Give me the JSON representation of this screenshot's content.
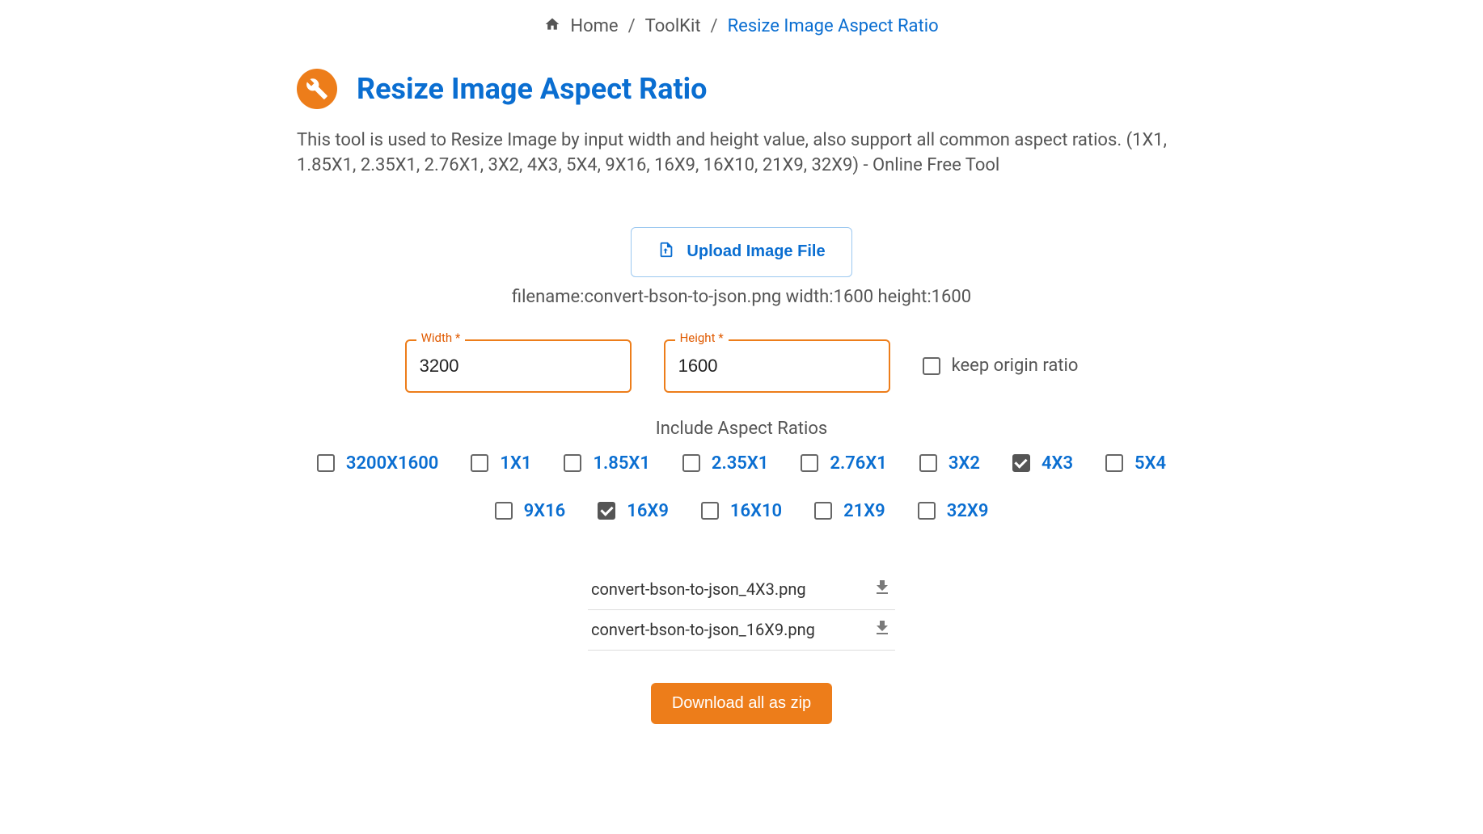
{
  "breadcrumb": {
    "home": "Home",
    "mid": "ToolKit",
    "current": "Resize Image Aspect Ratio"
  },
  "title": "Resize Image Aspect Ratio",
  "description": "This tool is used to Resize Image by input width and height value, also support all common aspect ratios. (1X1, 1.85X1, 2.35X1, 2.76X1, 3X2, 4X3, 5X4, 9X16, 16X9, 16X10, 21X9, 32X9) - Online Free Tool",
  "upload": {
    "label": "Upload Image File"
  },
  "file_meta": "filename:convert-bson-to-json.png width:1600 height:1600",
  "fields": {
    "width_label": "Width *",
    "width_value": "3200",
    "height_label": "Height *",
    "height_value": "1600",
    "keep_ratio_label": "keep origin ratio"
  },
  "ratios_section_label": "Include Aspect Ratios",
  "ratios": [
    {
      "label": "3200X1600",
      "checked": false
    },
    {
      "label": "1X1",
      "checked": false
    },
    {
      "label": "1.85X1",
      "checked": false
    },
    {
      "label": "2.35X1",
      "checked": false
    },
    {
      "label": "2.76X1",
      "checked": false
    },
    {
      "label": "3X2",
      "checked": false
    },
    {
      "label": "4X3",
      "checked": true
    },
    {
      "label": "5X4",
      "checked": false
    },
    {
      "label": "9X16",
      "checked": false
    },
    {
      "label": "16X9",
      "checked": true
    },
    {
      "label": "16X10",
      "checked": false
    },
    {
      "label": "21X9",
      "checked": false
    },
    {
      "label": "32X9",
      "checked": false
    }
  ],
  "outputs": [
    "convert-bson-to-json_4X3.png",
    "convert-bson-to-json_16X9.png"
  ],
  "download_all_label": "Download all as zip"
}
